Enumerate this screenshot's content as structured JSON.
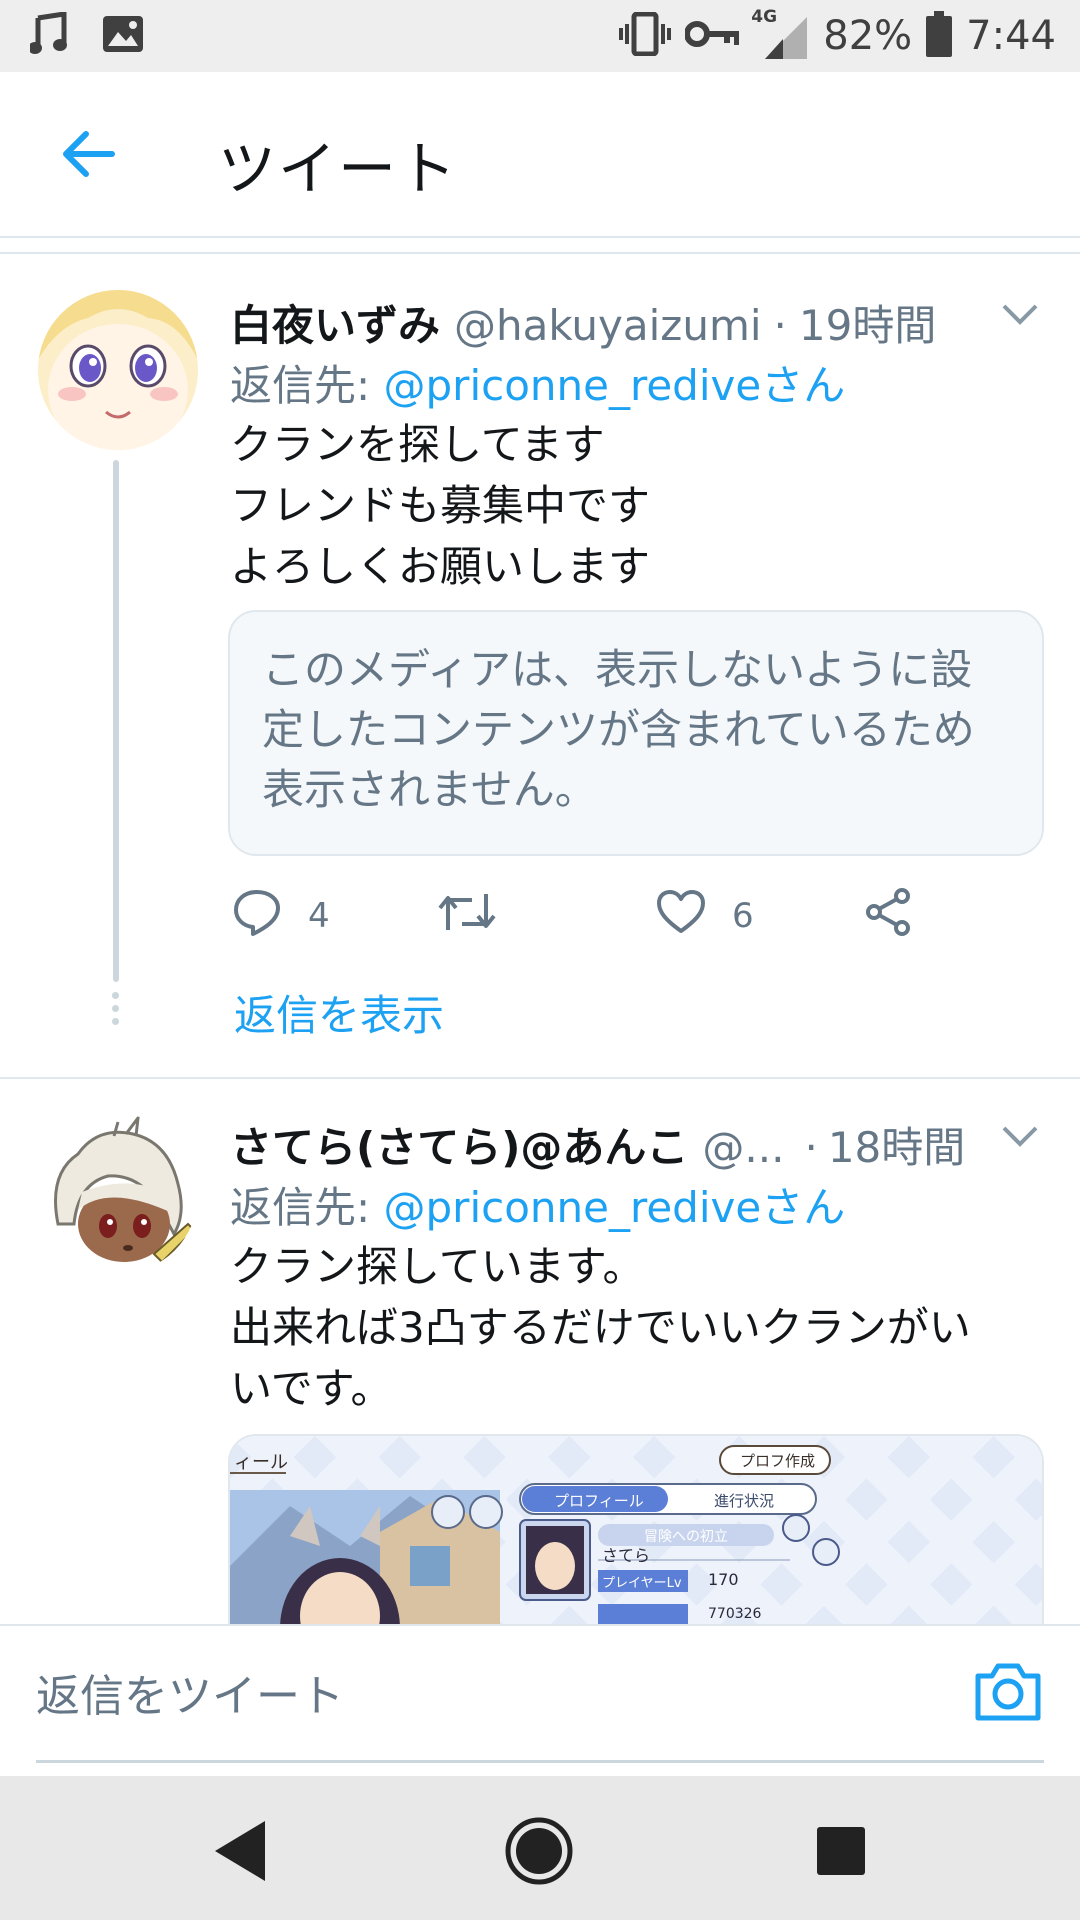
{
  "status_bar": {
    "network": "4G",
    "battery": "82%",
    "time": "7:44"
  },
  "header": {
    "title": "ツイート"
  },
  "tweets": [
    {
      "name": "白夜いずみ",
      "handle": "@hakuyaizumi",
      "dot": "·",
      "time": "19時間",
      "reply_prefix": "返信先: ",
      "reply_to": "@priconne_rediveさん",
      "lines": [
        "クランを探してます",
        "フレンドも募集中です",
        "よろしくお願いします"
      ],
      "sensitive_notice": "このメディアは、表示しないように設定したコンテンツが含まれているため表示されません。",
      "reply_count": "4",
      "like_count": "6",
      "show_replies": "返信を表示"
    },
    {
      "name": "さてら(さてら)@あんこ",
      "handle": "@...",
      "dot": "·",
      "time": "18時間",
      "reply_prefix": "返信先: ",
      "reply_to": "@priconne_rediveさん",
      "lines": [
        "クラン探しています。",
        "出来れば3凸するだけでいいクランがい",
        "いです。"
      ],
      "media": {
        "tab_profile": "プロフィール",
        "tab_progress": "進行状況",
        "profile_create": "プロフ作成",
        "header_fragment": "ィール",
        "subtitle": "冒険への初立",
        "player_name": "さてら",
        "player_lv_label": "プレイヤーLv",
        "player_lv": "170",
        "partial_value": "770326"
      }
    }
  ],
  "composer": {
    "placeholder": "返信をツイート"
  },
  "colors": {
    "accent": "#1da1f2",
    "secondary_text": "#657786",
    "border": "#e1e8ed"
  }
}
